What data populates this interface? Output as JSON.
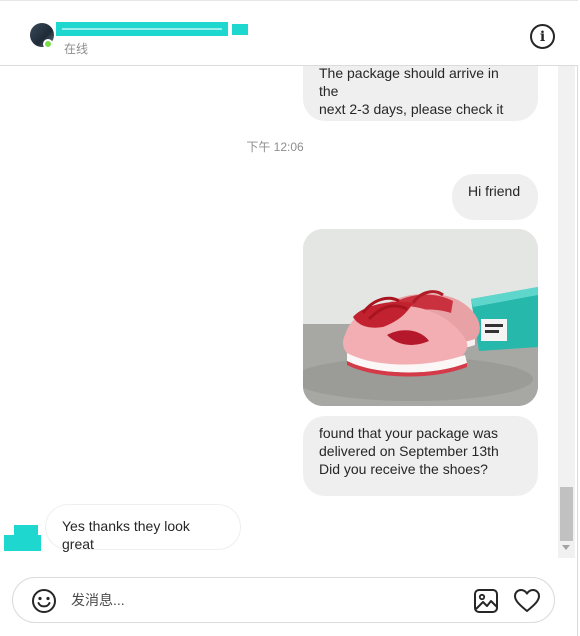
{
  "header": {
    "status": "在线",
    "icons": {
      "info": "info-icon",
      "online": "online-indicator"
    }
  },
  "thread": {
    "messages": [
      {
        "direction": "outgoing",
        "lines": [
          "The package should arrive in the",
          "next 2-3 days, please check it"
        ]
      },
      {
        "direction": "outgoing",
        "text": "Hi friend"
      },
      {
        "direction": "outgoing",
        "type": "photo",
        "subject": "pink sneaker on grey floor"
      },
      {
        "direction": "outgoing",
        "lines": [
          "found that your package was",
          "delivered on September 13th",
          "Did you receive the shoes?"
        ]
      },
      {
        "direction": "incoming",
        "text": "Yes thanks they look great"
      }
    ],
    "timestamp": "下午 12:06"
  },
  "composer": {
    "placeholder": "发消息...",
    "value": "",
    "icons": {
      "emoji": "emoji-icon",
      "image": "image-icon",
      "like": "heart-icon"
    }
  },
  "colors": {
    "outgoing_bubble": "#efefef",
    "online": "#78de45",
    "redaction": "#1ed8d0"
  }
}
